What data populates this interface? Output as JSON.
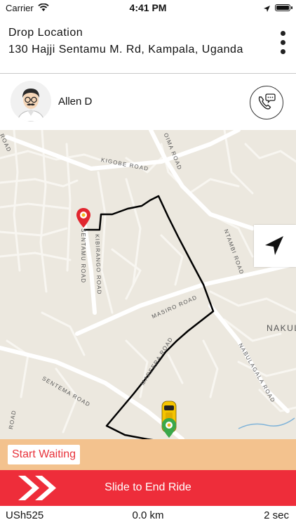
{
  "status_bar": {
    "carrier": "Carrier",
    "time": "4:41 PM"
  },
  "header": {
    "drop_label": "Drop Location",
    "drop_address": "130 Hajji Sentamu M. Rd, Kampala, Uganda"
  },
  "driver": {
    "name": "Allen D"
  },
  "map": {
    "road_labels": {
      "kigobe": "KIGOBE ROAD",
      "oima": "OIMA ROAD",
      "sentamu": "SENTAMU ROAD",
      "kibirango": "KIBIRANGO ROAD",
      "masiro": "MASIRO ROAD",
      "mareera": "MAREERA ROAD",
      "sentema": "SENTEMA ROAD",
      "nabulagala": "NABULAGALA ROAD",
      "ntambi": "NTAMBI ROAD",
      "road_top_left": "ROAD",
      "road_left_lower": "ROAD"
    },
    "area_label": "NAKUL"
  },
  "actions": {
    "start_waiting": "Start Waiting",
    "slide_to_end": "Slide to End Ride"
  },
  "trip": {
    "fare": "USh525",
    "distance": "0.0 km",
    "duration": "2 sec"
  },
  "colors": {
    "accent_red": "#ee2d3a",
    "waiting_bar": "#f3c28e",
    "route": "#000000",
    "map_bg": "#ece8df"
  }
}
